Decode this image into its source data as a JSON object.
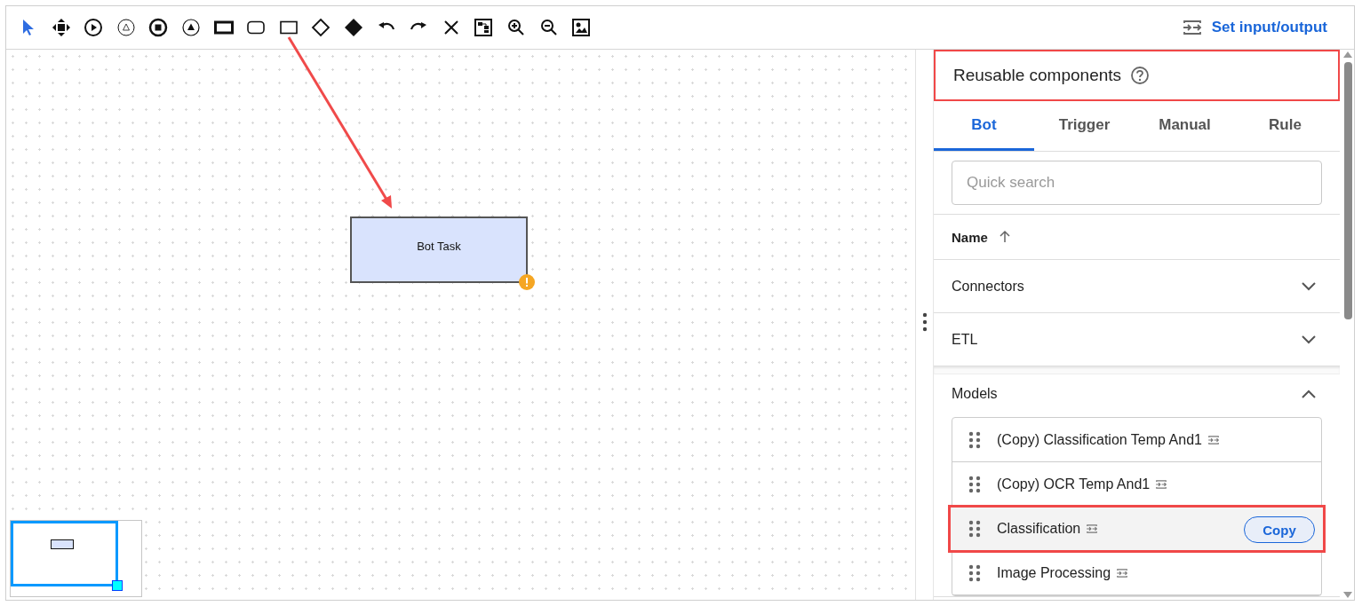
{
  "toolbar": {
    "tools": [
      {
        "kind": "pointer",
        "selected": true
      },
      {
        "kind": "move",
        "selected": false
      },
      {
        "kind": "start",
        "selected": false
      },
      {
        "kind": "intermediate",
        "selected": false
      },
      {
        "kind": "end",
        "selected": false
      },
      {
        "kind": "escalation",
        "selected": false
      },
      {
        "kind": "thick-task",
        "selected": false
      },
      {
        "kind": "rounded-task",
        "selected": false
      },
      {
        "kind": "task",
        "selected": false
      },
      {
        "kind": "gateway",
        "selected": false
      },
      {
        "kind": "filled-gateway",
        "selected": false
      },
      {
        "kind": "undo",
        "selected": false
      },
      {
        "kind": "redo",
        "selected": false
      },
      {
        "kind": "delete",
        "selected": false
      },
      {
        "kind": "layout",
        "selected": false
      },
      {
        "kind": "zoom-in",
        "selected": false
      },
      {
        "kind": "zoom-out",
        "selected": false
      },
      {
        "kind": "image",
        "selected": false
      }
    ],
    "set_io_label": "Set input/output"
  },
  "canvas": {
    "nodes": [
      {
        "label": "Bot Task",
        "warning": true
      }
    ]
  },
  "panel": {
    "title": "Reusable components",
    "title_highlighted": true,
    "tabs": [
      {
        "label": "Bot",
        "selected": true
      },
      {
        "label": "Trigger",
        "selected": false
      },
      {
        "label": "Manual",
        "selected": false
      },
      {
        "label": "Rule",
        "selected": false
      }
    ],
    "search": {
      "placeholder": "Quick search"
    },
    "sort": {
      "label": "Name"
    },
    "groups": [
      {
        "name": "Connectors",
        "expanded": false
      },
      {
        "name": "ETL",
        "expanded": false
      },
      {
        "name": "Models",
        "expanded": true,
        "items": [
          {
            "name": "(Copy) Classification Temp And1",
            "hovered": false,
            "highlighted": false
          },
          {
            "name": "(Copy) OCR Temp And1",
            "hovered": false,
            "highlighted": false
          },
          {
            "name": "Classification",
            "hovered": true,
            "highlighted": true,
            "action": "Copy"
          },
          {
            "name": "Image Processing",
            "hovered": false,
            "highlighted": false
          }
        ]
      }
    ]
  }
}
